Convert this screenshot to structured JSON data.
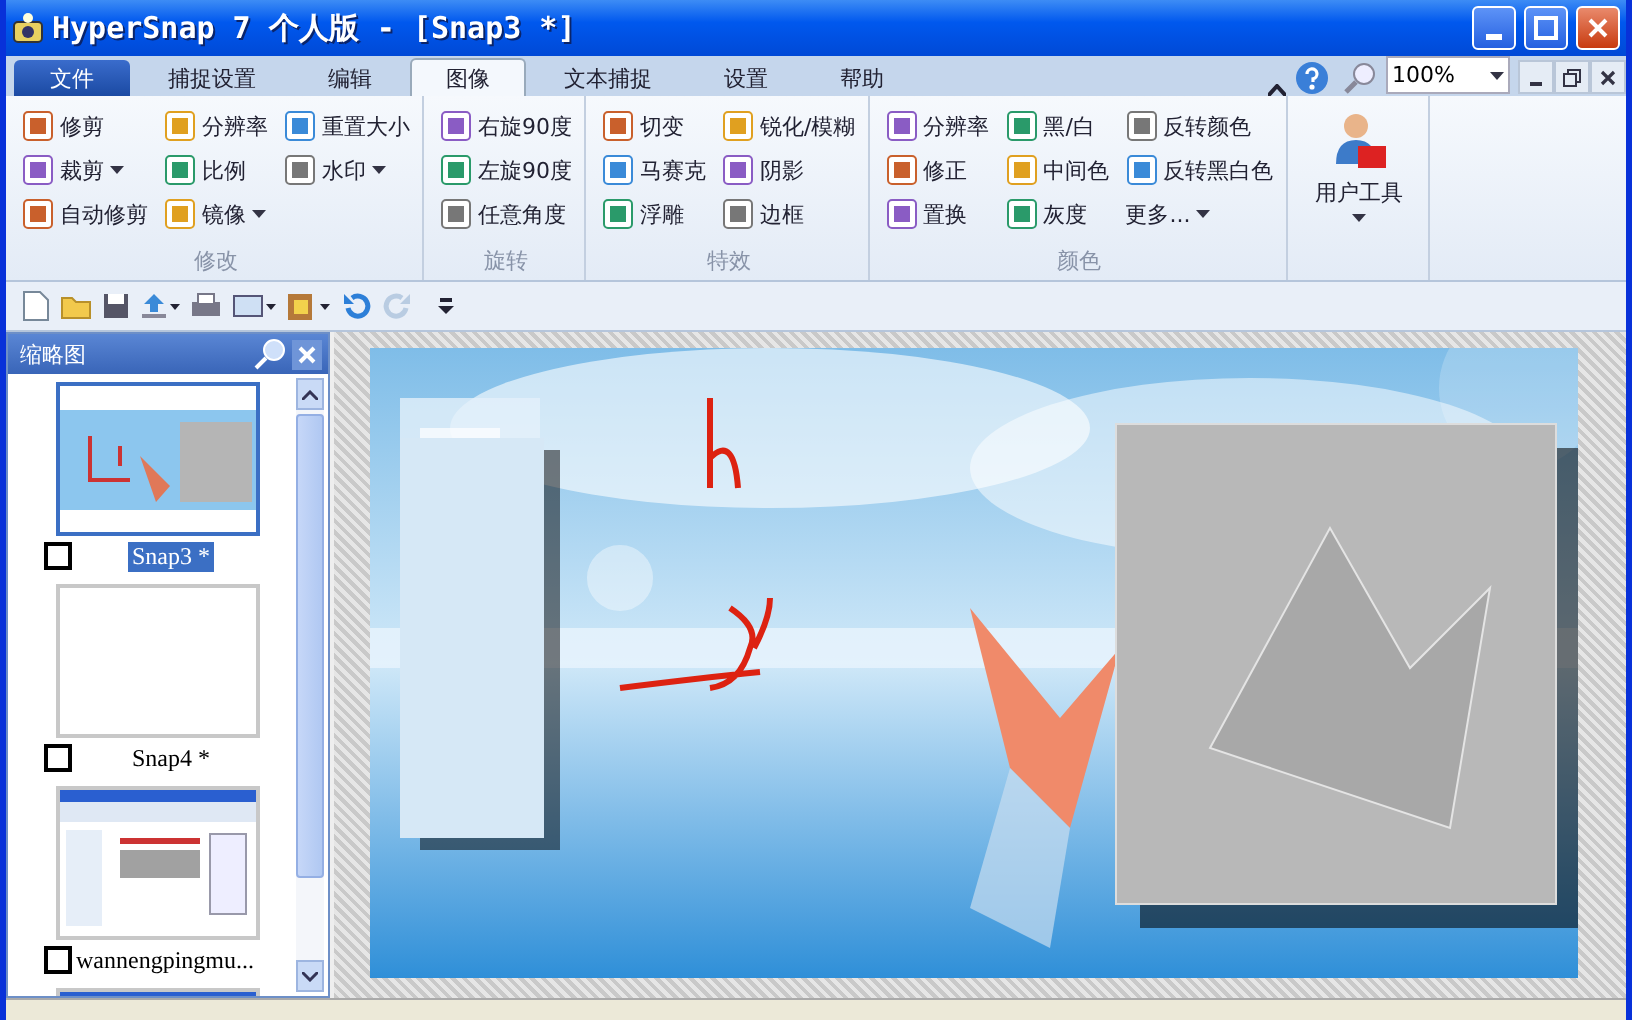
{
  "window": {
    "title": "HyperSnap 7 个人版 - [Snap3 *]"
  },
  "menu_tabs": [
    {
      "label": "文件",
      "selected": false,
      "kind": "file"
    },
    {
      "label": "捕捉设置",
      "selected": false,
      "kind": "tab"
    },
    {
      "label": "编辑",
      "selected": false,
      "kind": "tab"
    },
    {
      "label": "图像",
      "selected": true,
      "kind": "tab"
    },
    {
      "label": "文本捕捉",
      "selected": false,
      "kind": "tab"
    },
    {
      "label": "设置",
      "selected": false,
      "kind": "tab"
    },
    {
      "label": "帮助",
      "selected": false,
      "kind": "tab"
    }
  ],
  "zoom": "100%",
  "ribbon_groups": [
    {
      "title": "修改",
      "items": [
        {
          "label": "修剪"
        },
        {
          "label": "分辨率"
        },
        {
          "label": "重置大小"
        },
        {
          "label": "裁剪",
          "dropdown": true
        },
        {
          "label": "比例"
        },
        {
          "label": "水印",
          "dropdown": true
        },
        {
          "label": "自动修剪"
        },
        {
          "label": "镜像",
          "dropdown": true
        }
      ]
    },
    {
      "title": "旋转",
      "items": [
        {
          "label": "右旋90度"
        },
        {
          "label": "左旋90度"
        },
        {
          "label": "任意角度"
        }
      ]
    },
    {
      "title": "特效",
      "items": [
        {
          "label": "切变"
        },
        {
          "label": "锐化/模糊"
        },
        {
          "label": "马赛克"
        },
        {
          "label": "阴影"
        },
        {
          "label": "浮雕"
        },
        {
          "label": "边框"
        }
      ]
    },
    {
      "title": "颜色",
      "items": [
        {
          "label": "分辨率"
        },
        {
          "label": "黑/白"
        },
        {
          "label": "反转颜色"
        },
        {
          "label": "修正"
        },
        {
          "label": "中间色"
        },
        {
          "label": "反转黑白色"
        },
        {
          "label": "置换"
        },
        {
          "label": "灰度"
        },
        {
          "label": "更多...",
          "dropdown": true,
          "no_icon": true
        }
      ]
    },
    {
      "large": {
        "label": "用户工具",
        "dropdown": true
      }
    }
  ],
  "thumbnail_panel": {
    "title": "缩略图",
    "thumbnails": [
      {
        "caption": "Snap3 *",
        "selected": true,
        "checked": false
      },
      {
        "caption": "Snap4 *",
        "selected": false,
        "checked": false,
        "kind": "blank"
      },
      {
        "caption": "wannengpingmu...",
        "selected": false,
        "checked": false,
        "kind": "screenshot"
      },
      {
        "selected": false,
        "kind": "screenshot"
      }
    ]
  }
}
